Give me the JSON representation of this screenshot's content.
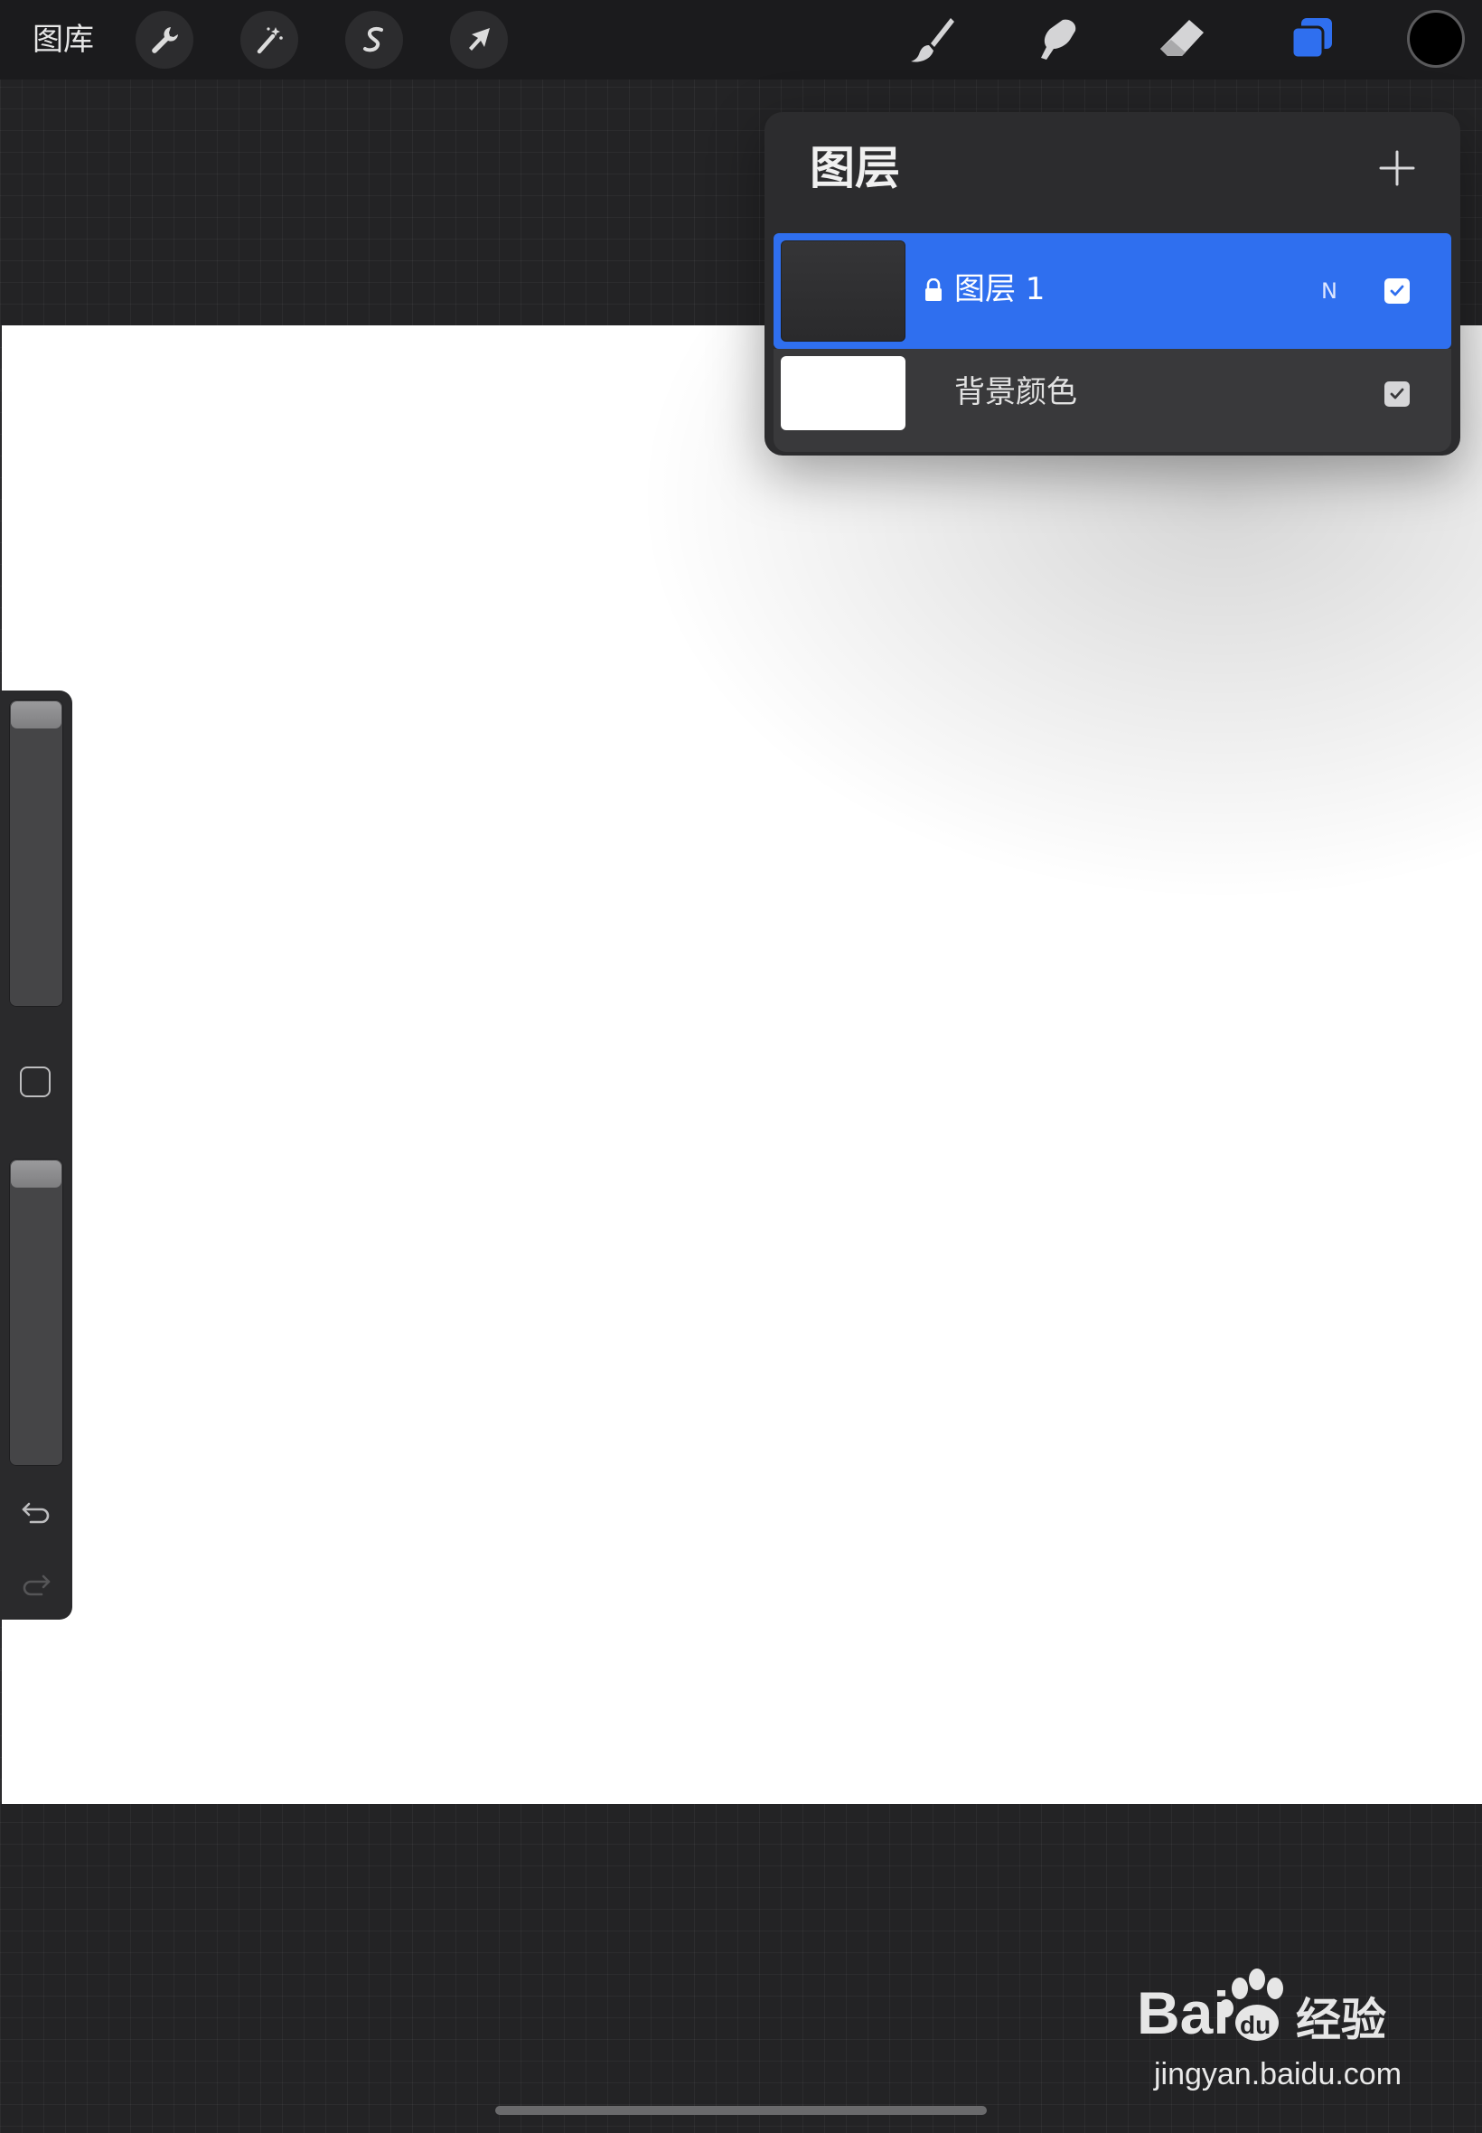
{
  "toolbar": {
    "gallery_label": "图库",
    "left_tools": [
      {
        "name": "actions",
        "icon": "wrench-icon"
      },
      {
        "name": "adjustments",
        "icon": "magic-wand-icon"
      },
      {
        "name": "selection",
        "icon": "selection-s-icon"
      },
      {
        "name": "transform",
        "icon": "arrow-cursor-icon"
      }
    ],
    "right_tools": [
      {
        "name": "paint",
        "icon": "brush-icon"
      },
      {
        "name": "smudge",
        "icon": "smudge-icon"
      },
      {
        "name": "erase",
        "icon": "eraser-icon"
      },
      {
        "name": "layers",
        "icon": "layers-icon",
        "active": true
      }
    ],
    "current_color": "#000000"
  },
  "layers_panel": {
    "title": "图层",
    "add_icon": "plus-icon",
    "layers": [
      {
        "name": "图层 1",
        "blend_mode": "N",
        "locked": true,
        "visible": true,
        "selected": true
      },
      {
        "name": "背景颜色",
        "visible": true,
        "selected": false
      }
    ]
  },
  "sidebar": {
    "controls": [
      "brush-size-slider",
      "modify-button",
      "opacity-slider",
      "undo-icon",
      "redo-icon"
    ]
  },
  "colors": {
    "accent": "#2f6fef",
    "toolbar_bg": "#1b1b1d",
    "panel_bg": "#2c2c2e",
    "canvas": "#ffffff"
  },
  "watermark": {
    "brand": "Baidu经验",
    "url": "jingyan.baidu.com"
  }
}
